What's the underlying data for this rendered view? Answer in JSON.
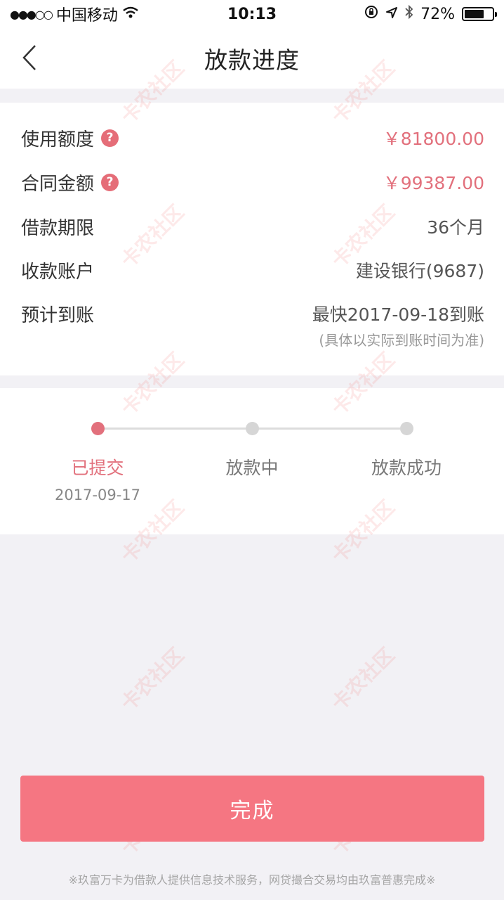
{
  "status_bar": {
    "signal": "●●●○○",
    "carrier": "中国移动",
    "time": "10:13",
    "battery": "72%",
    "battery_level": 0.72
  },
  "nav": {
    "title": "放款进度"
  },
  "info": {
    "rows": [
      {
        "label": "使用额度",
        "value": "￥81800.00",
        "has_help": true
      },
      {
        "label": "合同金额",
        "value": "￥99387.00",
        "has_help": true
      },
      {
        "label": "借款期限",
        "value": "36个月",
        "has_help": false
      },
      {
        "label": "收款账户",
        "value": "建设银行(9687)",
        "has_help": false
      },
      {
        "label": "预计到账",
        "value": "最快2017-09-18到账",
        "has_help": false
      }
    ],
    "note": "(具体以实际到账时间为准)"
  },
  "progress": {
    "steps": [
      {
        "label": "已提交",
        "date": "2017-09-17",
        "active": true
      },
      {
        "label": "放款中",
        "date": "",
        "active": false
      },
      {
        "label": "放款成功",
        "date": "",
        "active": false
      }
    ]
  },
  "actions": {
    "done_label": "完成"
  },
  "footer": {
    "note": "※玖富万卡为借款人提供信息技术服务，网贷撮合交易均由玖富普惠完成※"
  },
  "watermark": {
    "text": "卡农社区"
  },
  "colors": {
    "accent": "#e2707c",
    "button": "#f57682"
  }
}
